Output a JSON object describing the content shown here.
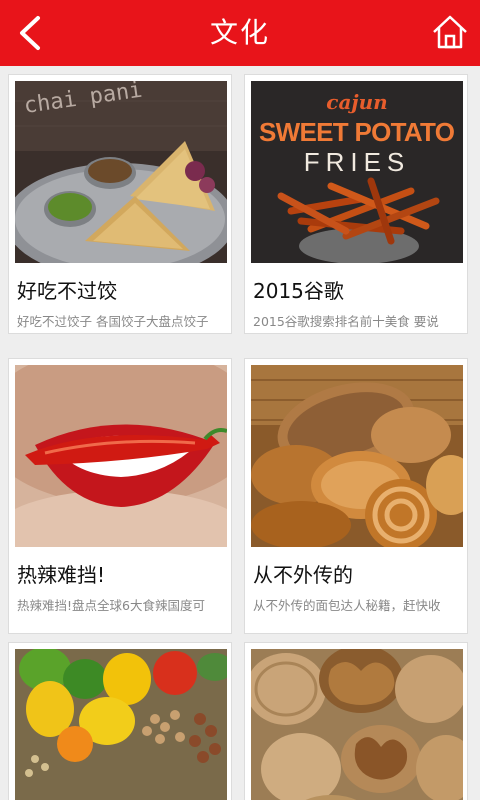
{
  "header": {
    "title": "文化",
    "back_icon": "chevron-left-icon",
    "home_icon": "home-icon",
    "bg_color": "#e8141a"
  },
  "articles": [
    {
      "title": "好吃不过饺",
      "subtitle": "好吃不过饺子 各国饺子大盘点饺子"
    },
    {
      "title": "2015谷歌",
      "subtitle": "2015谷歌搜索排名前十美食 要说"
    },
    {
      "title": "热辣难挡!",
      "subtitle": "热辣难挡!盘点全球6大食辣国度可"
    },
    {
      "title": "从不外传的",
      "subtitle": "从不外传的面包达人秘籍，赶快收"
    },
    {
      "title": "",
      "subtitle": ""
    },
    {
      "title": "",
      "subtitle": ""
    }
  ],
  "image_text": {
    "chai_pani": "chai pani",
    "cajun": "cajun",
    "sweet_potato": "SWEET POTATO",
    "fries": "FRIES"
  }
}
